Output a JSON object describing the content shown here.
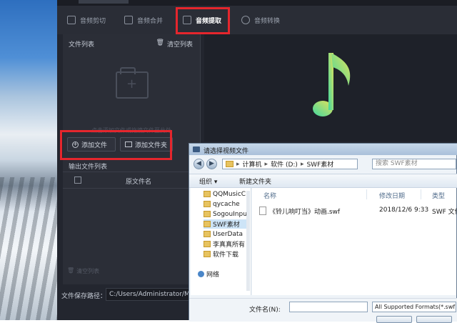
{
  "toolbar": {
    "items": [
      {
        "label": "音频剪切",
        "icon": "scissors-icon"
      },
      {
        "label": "音频合并",
        "icon": "merge-icon"
      },
      {
        "label": "音频提取",
        "icon": "extract-icon",
        "active": true
      },
      {
        "label": "音频转换",
        "icon": "convert-icon"
      }
    ]
  },
  "file_list": {
    "title": "文件列表",
    "clear_label": "清空列表",
    "drop_hint": "点击添加文件或拖拽文件至此处",
    "add_file_label": "添加文件",
    "add_folder_label": "添加文件夹"
  },
  "output_list": {
    "title": "输出文件列表",
    "column_name": "原文件名",
    "clear_label": "清空列表"
  },
  "save": {
    "label": "文件保存路径：",
    "path": "C:/Users/Administrator/Mu"
  },
  "dialog": {
    "title": "请选择视频文件",
    "address": [
      "计算机",
      "软件 (D:)",
      "SWF素材"
    ],
    "search_placeholder": "搜索 SWF素材",
    "organize_label": "组织 ▾",
    "new_folder_label": "新建文件夹",
    "nav_items": [
      "QQMusicC",
      "qycache",
      "SogouInpu",
      "SWF素材",
      "UserData",
      "李真真所有",
      "软件下载"
    ],
    "network_label": "网络",
    "columns": [
      "名称",
      "修改日期",
      "类型"
    ],
    "files": [
      {
        "name": "《铃儿响叮当》动画.swf",
        "date": "2018/12/6 9:33",
        "type": "SWF 文件"
      }
    ],
    "file_name_label": "文件名(N):",
    "file_type_value": "All Supported Formats(*.swf;"
  },
  "colors": {
    "accent_highlight": "#e5262d",
    "app_bg": "#23262f",
    "note_gradient_start": "#3fd8a0",
    "note_gradient_end": "#e6e25a"
  }
}
